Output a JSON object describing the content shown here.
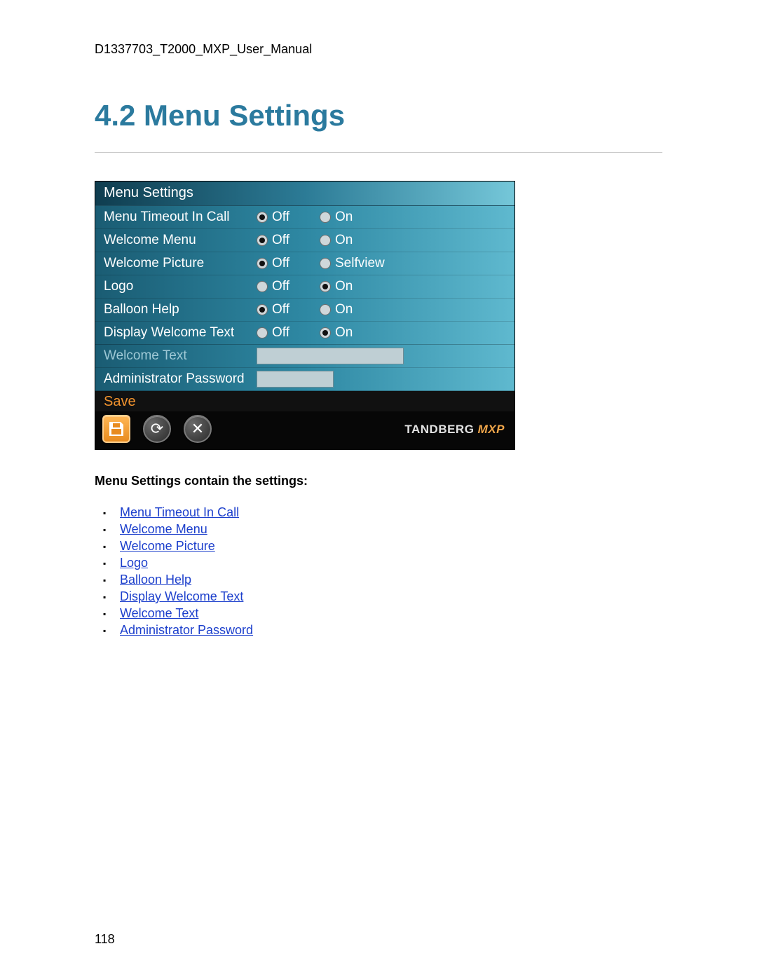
{
  "doc": {
    "header": "D1337703_T2000_MXP_User_Manual",
    "section_title": "4.2 Menu Settings",
    "page_number": "118"
  },
  "panel": {
    "title": "Menu Settings",
    "rows": [
      {
        "label": "Menu Timeout In Call",
        "opt1": "Off",
        "opt2": "On",
        "selected": "Off"
      },
      {
        "label": "Welcome Menu",
        "opt1": "Off",
        "opt2": "On",
        "selected": "Off"
      },
      {
        "label": "Welcome Picture",
        "opt1": "Off",
        "opt2": "Selfview",
        "selected": "Off"
      },
      {
        "label": "Logo",
        "opt1": "Off",
        "opt2": "On",
        "selected": "On"
      },
      {
        "label": "Balloon Help",
        "opt1": "Off",
        "opt2": "On",
        "selected": "Off"
      },
      {
        "label": "Display Welcome Text",
        "opt1": "Off",
        "opt2": "On",
        "selected": "On"
      }
    ],
    "welcome_text_label": "Welcome Text",
    "admin_pw_label": "Administrator Password",
    "save_label": "Save",
    "brand_main": "TANDBERG",
    "brand_suffix": " MXP"
  },
  "list": {
    "heading": "Menu Settings contain the settings:",
    "items": [
      "Menu Timeout In Call",
      "Welcome Menu",
      "Welcome Picture",
      "Logo",
      "Balloon Help",
      "Display Welcome Text",
      "Welcome Text",
      "Administrator Password"
    ]
  }
}
